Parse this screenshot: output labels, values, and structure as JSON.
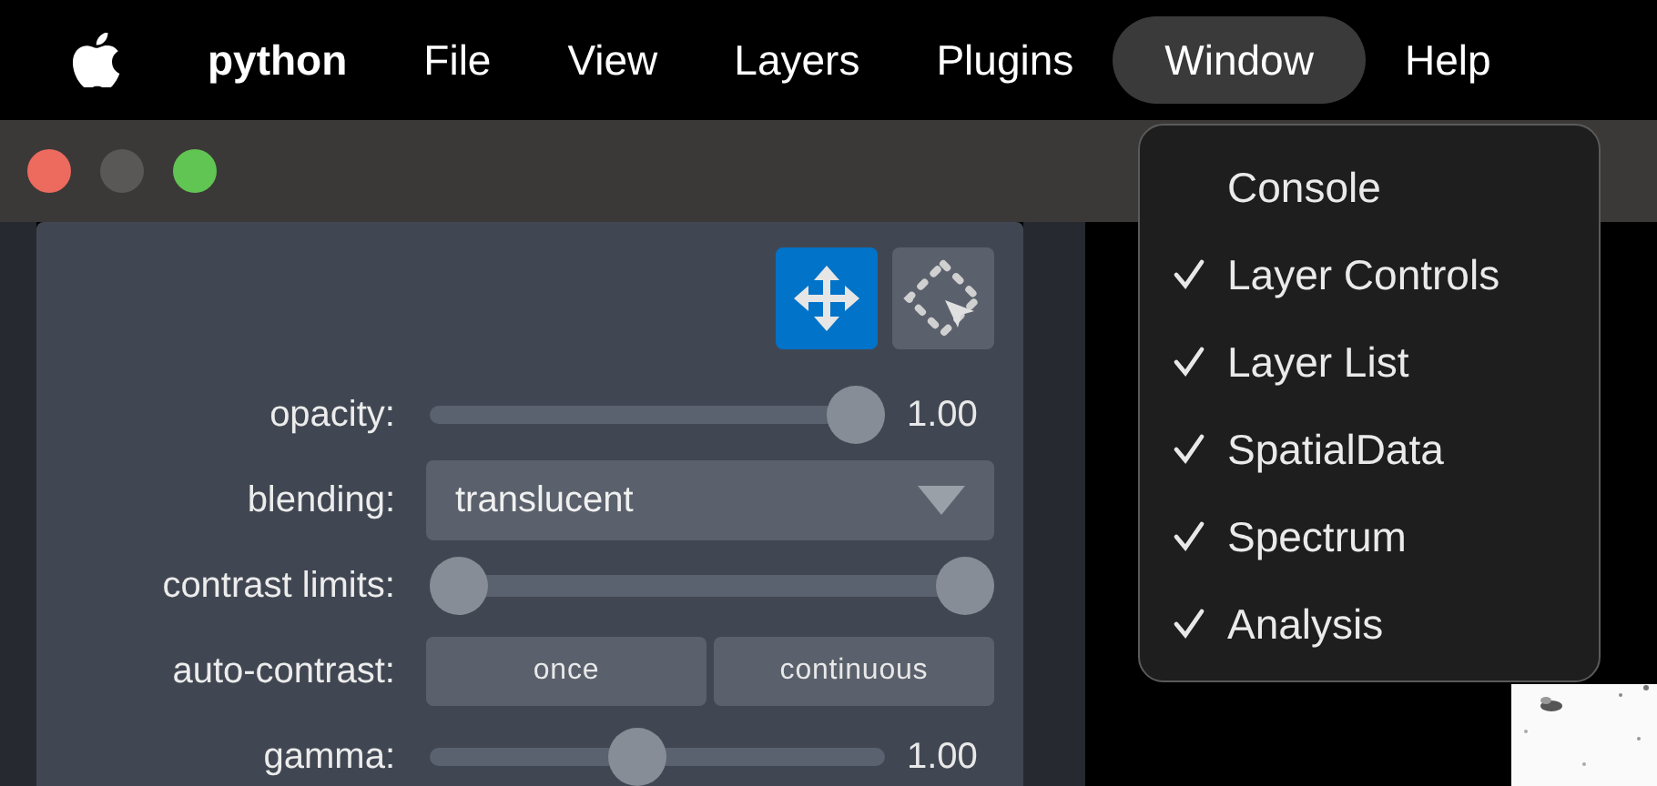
{
  "menubar": {
    "items": [
      {
        "label": "python",
        "kind": "app",
        "selected": false
      },
      {
        "label": "File",
        "kind": "menu",
        "selected": false
      },
      {
        "label": "View",
        "kind": "menu",
        "selected": false
      },
      {
        "label": "Layers",
        "kind": "menu",
        "selected": false
      },
      {
        "label": "Plugins",
        "kind": "menu",
        "selected": false
      },
      {
        "label": "Window",
        "kind": "menu",
        "selected": true
      },
      {
        "label": "Help",
        "kind": "menu",
        "selected": false
      }
    ]
  },
  "window_menu": {
    "items": [
      {
        "label": "Console",
        "checked": false
      },
      {
        "label": "Layer Controls",
        "checked": true
      },
      {
        "label": "Layer List",
        "checked": true
      },
      {
        "label": "SpatialData",
        "checked": true
      },
      {
        "label": "Spectrum",
        "checked": true
      },
      {
        "label": "Analysis",
        "checked": true
      }
    ]
  },
  "layer_controls": {
    "tools": [
      {
        "kind": "move",
        "selected": true
      },
      {
        "kind": "select",
        "selected": false
      }
    ],
    "rows": [
      {
        "kind": "slider",
        "label": "opacity:",
        "level": 1.0,
        "reading": "1.00"
      },
      {
        "kind": "dropdown",
        "label": "blending:",
        "value": "translucent"
      },
      {
        "kind": "range",
        "label": "contrast limits:",
        "handles": [
          {
            "level": 0
          },
          {
            "level": 1
          }
        ]
      },
      {
        "kind": "buttons",
        "label": "auto-contrast:",
        "buttons": [
          "once",
          "continuous"
        ]
      },
      {
        "kind": "slider",
        "label": "gamma:",
        "level": 0.45,
        "reading": "1.00"
      }
    ]
  }
}
